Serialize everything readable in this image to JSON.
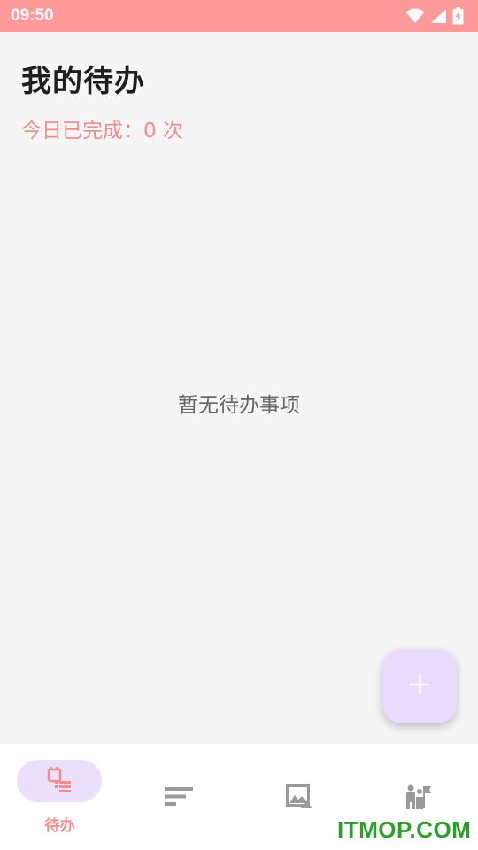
{
  "status_bar": {
    "time": "09:50",
    "icons": [
      "wifi-icon",
      "signal-icon",
      "battery-charging-icon"
    ],
    "color": "#ff9a9a"
  },
  "header": {
    "title": "我的待办",
    "today_done": "今日已完成：0 次"
  },
  "main": {
    "empty_text": "暂无待办事项"
  },
  "fab": {
    "icon": "plus-icon",
    "color": "#eadcff"
  },
  "bottom_nav": {
    "items": [
      {
        "icon": "todo-list-icon",
        "label": "待办",
        "active": true
      },
      {
        "icon": "sort-lines-icon",
        "label": "",
        "active": false
      },
      {
        "icon": "image-icon",
        "label": "",
        "active": false
      },
      {
        "icon": "people-flag-icon",
        "label": "",
        "active": false
      }
    ],
    "accent_color": "#f08c8c"
  },
  "watermark": "ITMOP.COM"
}
